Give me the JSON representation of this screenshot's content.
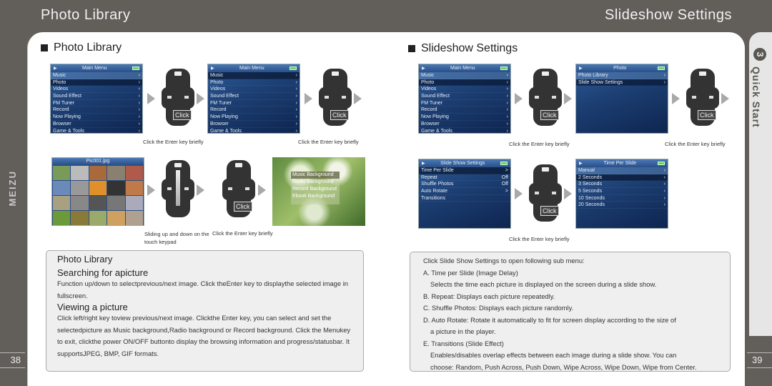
{
  "header": {
    "left_title": "Photo Library",
    "right_title": "Slideshow Settings"
  },
  "side_tab": {
    "number": "3",
    "label": "Quick Start"
  },
  "brand": "MEIZU",
  "page_numbers": {
    "left": "38",
    "right": "39"
  },
  "left": {
    "section_title": "Photo Library",
    "main_menu": {
      "title": "Main Menu",
      "items": [
        "Music",
        "Photo",
        "Videos",
        "Sound Effect",
        "FM Tuner",
        "Record",
        "Now Playing",
        "Browser",
        "Game & Tools"
      ]
    },
    "click_label": "Click",
    "caption_enter": "Click the Enter key briefly",
    "thumb_title": "Pic001.jpg",
    "slide_caption": "Sliding up and down on the touch keypad",
    "bg_menu": [
      "Music Background",
      "Radio Background",
      "Record Background",
      "Ebook Background"
    ],
    "box": {
      "heading": "Photo Library",
      "sub1": "Searching for apicture",
      "p1": "Function up/down to selectprevious/next image. Click theEnter key to displaythe selected image in fullscreen.",
      "sub2": "Viewing a picture",
      "p2": "Click left/right key toview previous/next image. Clickthe Enter key, you can select and set the selectedpicture as Music background,Radio background or Record background. Click the Menukey to exit, clickthe power ON/OFF buttonto display the browsing information and progress/statusbar. It supportsJPEG, BMP, GIF formats."
    }
  },
  "right": {
    "section_title": "Slideshow Settings",
    "photo_menu": {
      "title": "Photo",
      "items": [
        "Photo Library",
        "Slide Show Settings"
      ]
    },
    "slideshow_menu": {
      "title": "Slide Show Settings",
      "items": [
        {
          "label": "Time Per Slide",
          "value": ">"
        },
        {
          "label": "Repeat",
          "value": "Off"
        },
        {
          "label": "Shuffle Photos",
          "value": "Off"
        },
        {
          "label": "Auto Rotate",
          "value": ">"
        },
        {
          "label": "Transitions",
          "value": ""
        }
      ]
    },
    "time_menu": {
      "title": "Time Per Slide",
      "items": [
        "Manual",
        "2 Seconds",
        "3 Seconds",
        "5 Seconds",
        "10 Seconds",
        "20 Seconds"
      ]
    },
    "caption_enter": "Click the Enter key briefly",
    "box": {
      "lines": [
        "Click Slide Show Settings to open following sub menu:",
        "A. Time per Slide (Image Delay)",
        "Selects the time each picture is displayed on the screen during a slide show.",
        "B. Repeat: Displays each picture repeatedly.",
        "C. Shuffle Photos: Displays each picture randomly.",
        "D. Auto Rotate: Rotate it automatically to fit for screen display according to the size of",
        "a picture in the player.",
        "E. Transitions (Slide Effect)",
        "Enables/disables overlap effects between each image during a slide show. You can",
        "choose: Random, Push Across, Push Down, Wipe Across, Wipe Down, Wipe from Center."
      ]
    }
  }
}
